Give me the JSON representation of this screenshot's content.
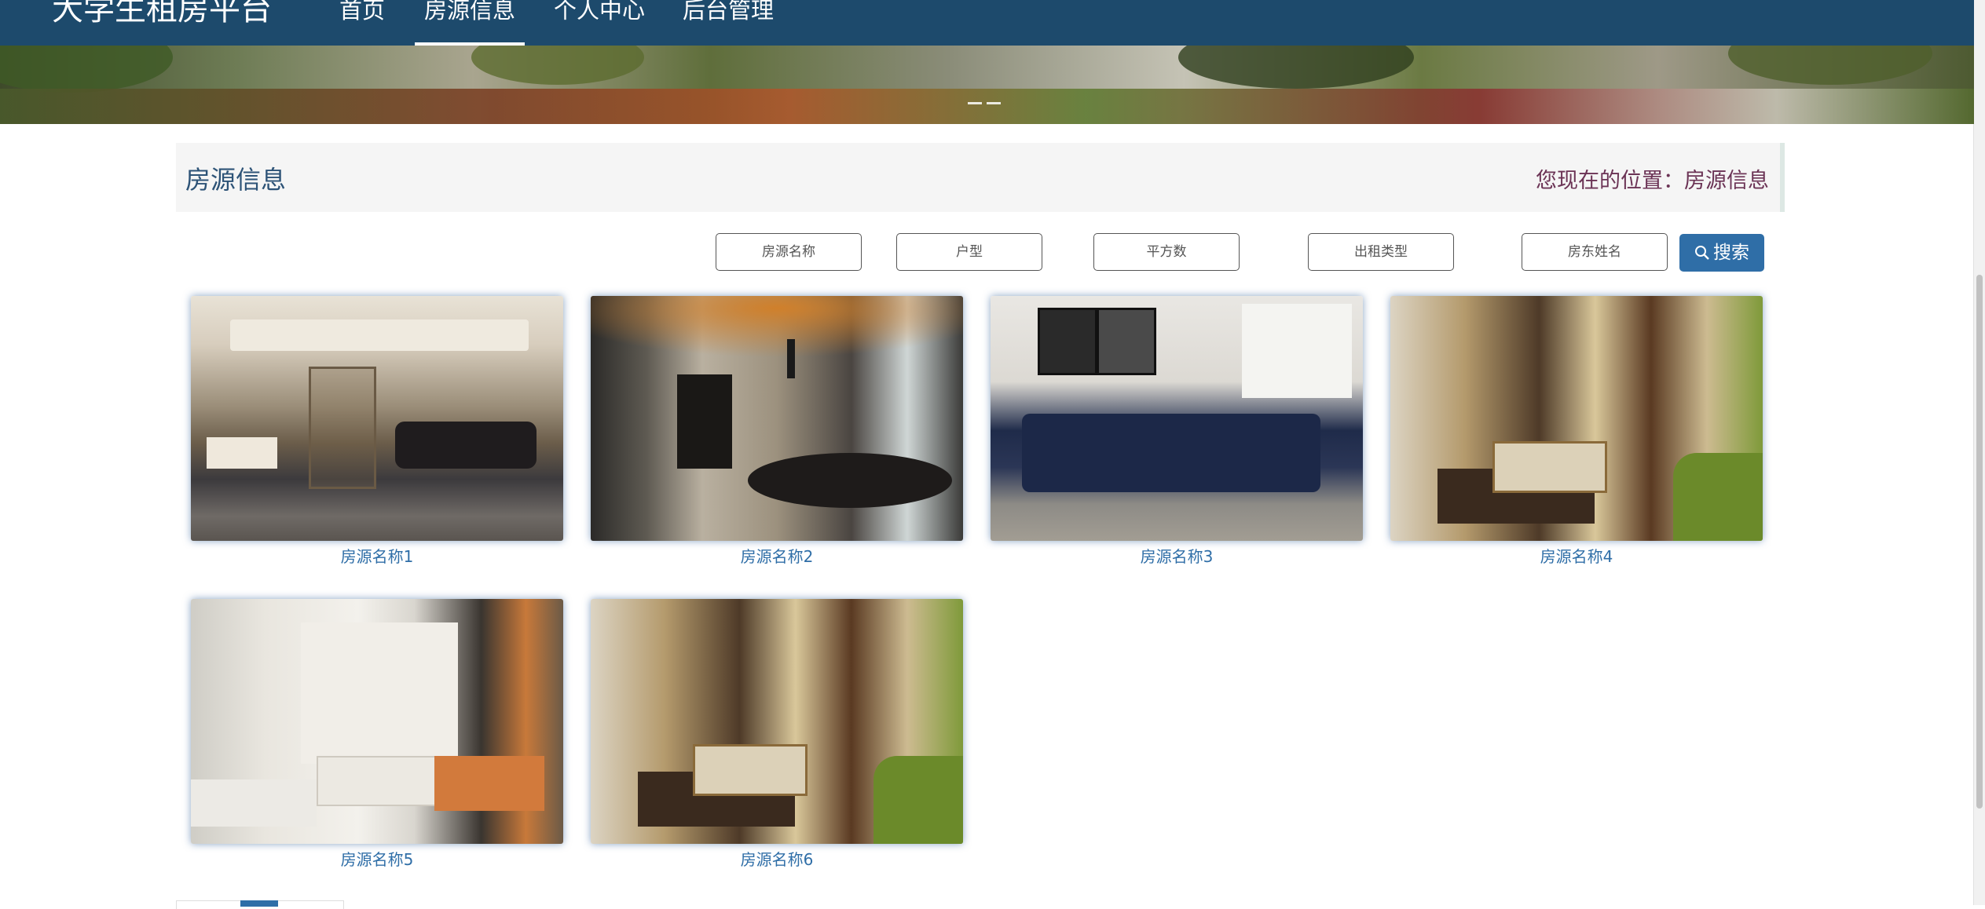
{
  "navbar": {
    "brand": "大学生租房平台",
    "items": [
      {
        "label": "首页",
        "active": false
      },
      {
        "label": "房源信息",
        "active": true
      },
      {
        "label": "个人中心",
        "active": false
      },
      {
        "label": "后台管理",
        "active": false
      }
    ]
  },
  "header": {
    "title": "房源信息",
    "breadcrumb": "您现在的位置：房源信息"
  },
  "search": {
    "fields": [
      {
        "placeholder": "房源名称",
        "value": ""
      },
      {
        "placeholder": "户型",
        "value": ""
      },
      {
        "placeholder": "平方数",
        "value": ""
      },
      {
        "placeholder": "出租类型",
        "value": ""
      },
      {
        "placeholder": "房东姓名",
        "value": ""
      }
    ],
    "button_label": "搜索",
    "button_icon": "search-icon"
  },
  "listings": [
    {
      "name": "房源名称1"
    },
    {
      "name": "房源名称2"
    },
    {
      "name": "房源名称3"
    },
    {
      "name": "房源名称4"
    },
    {
      "name": "房源名称5"
    },
    {
      "name": "房源名称6"
    }
  ],
  "colors": {
    "navbar": "#1d4a6c",
    "accent": "#2f6ea7",
    "breadcrumb": "#6b3355"
  }
}
